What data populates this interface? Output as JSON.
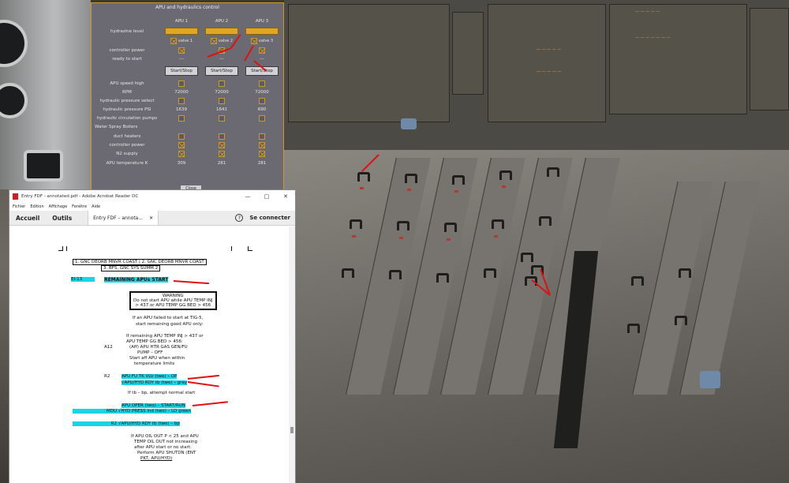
{
  "apu_dialog": {
    "title": "APU and hydraulics control",
    "columns": [
      "APU 1",
      "APU 2",
      "APU 3"
    ],
    "rows": {
      "hydrazine_level": "hydrazine level",
      "valves": [
        "valve 1",
        "valve 2",
        "valve 3"
      ],
      "controller_power": "controller power",
      "ready_to_start": "ready to start",
      "ready_values": [
        "---",
        "---",
        "---"
      ],
      "start_stop": "Start/Stop",
      "apu_speed_high": "APU speed high",
      "rpm": "RPM",
      "rpm_values": [
        "72000",
        "72000",
        "72000"
      ],
      "hydraulic_pressure_select": "hydraulic pressure select",
      "hydraulic_pressure_psi": "hydraulic pressure PSI",
      "psi_values": [
        "1639",
        "1641",
        "690"
      ],
      "hydraulic_circulation_pumps": "hydraulic circulation pumps",
      "water_spray_boilers": "Water Spray Boilers",
      "duct_heaters": "duct heaters",
      "controller_power_wsb": "controller power",
      "n2_supply": "N2 supply",
      "apu_temperature_k": "APU temperature K",
      "temp_values": [
        "309",
        "281",
        "281"
      ]
    },
    "close_label": "Close",
    "accent_color": "#e1a628"
  },
  "acrobat": {
    "window_title": "Entry FDF - annotated.pdf - Adobe Acrobat Reader DC",
    "menu": [
      "Fichier",
      "Edition",
      "Affichage",
      "Fenêtre",
      "Aide"
    ],
    "tabs": {
      "home": "Accueil",
      "tools": "Outils",
      "doc": "Entry FDF – annota..."
    },
    "help": "?",
    "connect": "Se connecter",
    "doc": {
      "ref_line1": "1.  GNC DEORB MNVR COAST | 2.  GNC DEORB MNVR COAST",
      "ref_line2": "3.  BFS, GNC SYS SUMM 2",
      "step_id": "EI-13",
      "heading": "REMAINING APUs START",
      "warning_title": "WARNING",
      "warning_l1": "Do not start APU while APU TEMP INJ",
      "warning_l2": "> 437 or APU TEMP GG BED > 456",
      "p1_l1": "If an APU failed to start at TIG-5,",
      "p1_l2": "start remaining good APU only:",
      "p2_l1": "If remaining APU TEMP INJ > 437 or",
      "p2_l2": "APU TEMP GG BED > 456:",
      "a12": "A12",
      "p2_l3": "(Aff) APU HTR GAS GEN/FU",
      "p2_l4": "PUMP – OFF",
      "p2_l5": "Start aff APU when within",
      "p2_l6": "temperature limits",
      "r2": "R2",
      "h1": "APU FU TK VLV (two) – OP",
      "h2": "√APU/HYD RDY tb (two) – gray",
      "p3": "If tb – bp, attempt normal start",
      "h3": "APU OPER (two) – START/RUN",
      "mdu": "MDU",
      "h4": "√HYD PRESS ind (two) – LO green",
      "r2b": "R2",
      "h5": "√APU/HYD RDY tb (two) – bp",
      "p4_l1": "If APU OIL OUT P < 25 and APU",
      "p4_l2": "TEMP OIL OUT not increasing",
      "p4_l3": "after APU start or no start:",
      "p4_l4": "Perform APU SHUTDN (ENT",
      "p4_l5": "PKT, APU/HYD)"
    },
    "highlight_color": "#19d4e4",
    "arrow_color": "#e01010"
  }
}
